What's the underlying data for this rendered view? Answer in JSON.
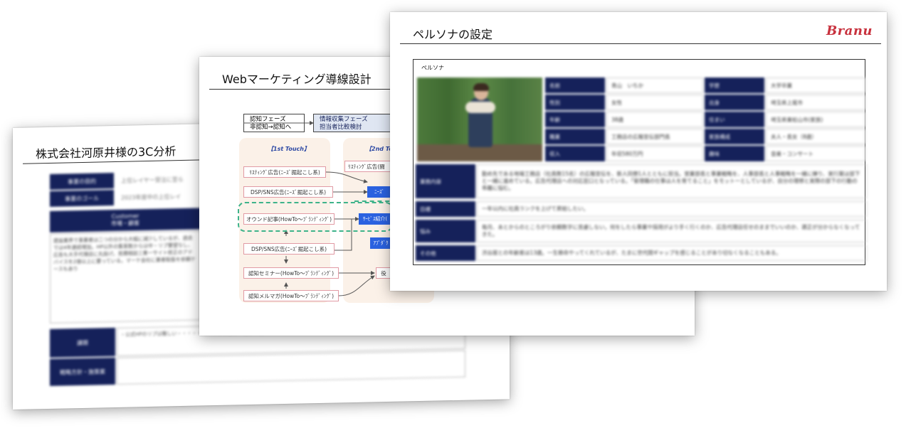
{
  "slide_3c": {
    "title": "株式会社河原井様の3C分析",
    "rows": [
      {
        "label": "事業の目的",
        "value": "上位レイヤー受注に至ら"
      },
      {
        "label": "事業のゴール",
        "value": "2023年度中の上位レイ"
      }
    ],
    "customer_head": "Customer",
    "customer_sub": "市場・顧客",
    "customer_body": "建設業界で事業者は二つの分から大幅に減少しているが、過去では4年連続増加。HP以外の集客数からは中・リプ要望なし、広告も大手代理店に丸投げ。見積相談三重一サイト修正のアドバイスを2億以上に要っている。マーケ会社に業者取扱を依頼ケースもあり",
    "issue_label": "課題",
    "issue_value": "・公式HPのリプは難しい・・・・・・・ ・SNS集め「通信特化」への施策の仕組みで対応する",
    "strategy_label": "戦略方針・施策案"
  },
  "slide_web": {
    "title": "Webマーケティング導線設計",
    "phase1_l1": "認知フェーズ",
    "phase1_l2": "非認知→認知へ",
    "phase2_l1": "情報収集フェーズ",
    "phase2_l2": "担当者比較検討",
    "col1_head": "【1st Touch】",
    "col2_head": "【2nd Tou",
    "items": {
      "listing1": "ﾘｽﾃｨﾝｸﾞ広告(ﾆｰｽﾞ掘起こし系)",
      "dsp1": "DSP/SNS広告(ﾆｰｽﾞ掘起こし系)",
      "owned": "オウンド記事(HowTo～ﾌﾞﾗﾝﾃﾞｨﾝｸﾞ)",
      "dsp2": "DSP/SNS広告(ﾆｰｽﾞ掘起こし系)",
      "seminar": "認知セミナー(HowTo～ﾌﾞﾗﾝﾃﾞｨﾝｸﾞ)",
      "mailmag": "認知メルマガ(HowTo～ﾌﾞﾗﾝﾃﾞｨﾝｸﾞ)",
      "listing2": "ﾘｽﾃｨﾝｸﾞ広告(闘",
      "needs": "ﾆｰｽﾞ",
      "service": "ｻｰﾋﾞｽ紹介(",
      "app": "ｱﾌﾟﾀﾞｸ",
      "role": "役"
    }
  },
  "slide_persona": {
    "title": "ペルソナの設定",
    "logo": "Branu",
    "frame_label": "ペルソナ",
    "grid": [
      [
        "名前",
        "青山　いちか",
        "学歴",
        "大学卒業"
      ],
      [
        "性別",
        "女性",
        "出身",
        "埼玉県上尾市"
      ],
      [
        "年齢",
        "38歳",
        "住まい",
        "埼玉県東松山市(家族)"
      ],
      [
        "職業",
        "工務店の広報宣伝部門長",
        "家族構成",
        "夫人・長女（8歳）"
      ],
      [
        "収入",
        "年収580万円",
        "趣味",
        "音楽・コンサート"
      ]
    ],
    "rows": [
      {
        "label": "業務内容",
        "value": "勤め先である地場工務店（社員数15名）の広報宣伝を、新人同僚1人とともに担当。営業部長と事業戦略を、人事部長と人事戦略を一緒に練り、実行案は部下と一緒に進めている。広告代理店への対応窓口となっている。「管理職の仕事は人を育てること」をモットーとしているが、自分の理想と実際の部下の行動の乖離に悩む。"
      },
      {
        "label": "目標",
        "value": "一年以内に社員ランクを上げて昇給したい。"
      },
      {
        "label": "悩み",
        "value": "毎月、あとからのところがり依頼数字に苦慮しない。何をしたら事業や採用がより手く行くのか、広告代理店任せのままでいいのか、適正が分からなくなってきた。"
      },
      {
        "label": "その他",
        "value": "渋谷居との年齢差は13歳。一生懸命やってくれているが、たまに世代間ギャップを感じることがあり切なくなることもある。"
      }
    ]
  }
}
